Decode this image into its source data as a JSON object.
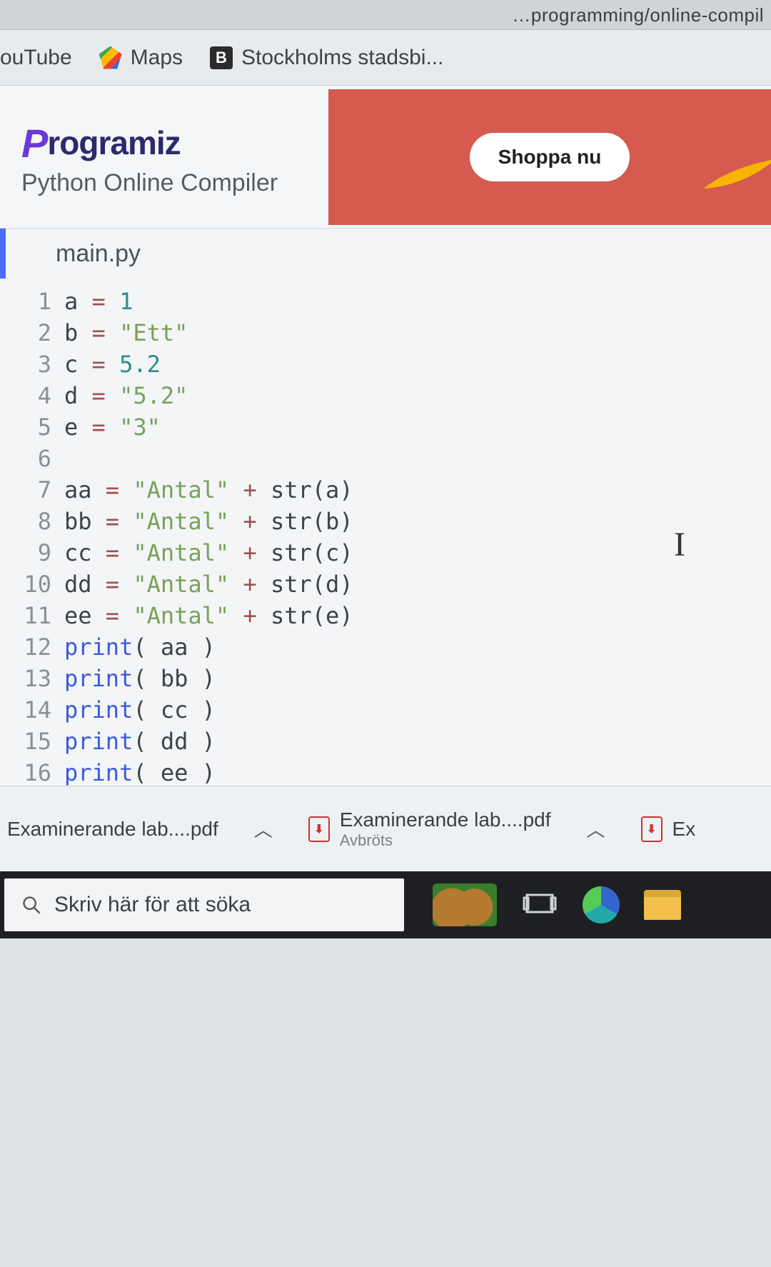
{
  "url_fragment": "…programming/online-compil",
  "bookmarks": {
    "youtube": "ouTube",
    "maps": "Maps",
    "stockholm": "Stockholms stadsbi..."
  },
  "header": {
    "brand_rest": "rogramiz",
    "subtitle": "Python Online Compiler",
    "ad_button": "Shoppa nu"
  },
  "editor": {
    "filename": "main.py",
    "lines": [
      {
        "n": "1",
        "html": "a <span class='tok-op'>=</span> <span class='tok-num'>1</span>"
      },
      {
        "n": "2",
        "html": "b <span class='tok-op'>=</span> <span class='tok-str'>\"Ett\"</span>"
      },
      {
        "n": "3",
        "html": "c <span class='tok-op'>=</span> <span class='tok-num'>5.2</span>"
      },
      {
        "n": "4",
        "html": "d <span class='tok-op'>=</span> <span class='tok-str'>\"5.2\"</span>"
      },
      {
        "n": "5",
        "html": "e <span class='tok-op'>=</span> <span class='tok-str'>\"3\"</span>"
      },
      {
        "n": "6",
        "html": ""
      },
      {
        "n": "7",
        "html": "aa <span class='tok-op'>=</span> <span class='tok-str'>\"Antal\"</span> <span class='tok-op'>+</span> str(a)"
      },
      {
        "n": "8",
        "html": "bb <span class='tok-op'>=</span> <span class='tok-str'>\"Antal\"</span> <span class='tok-op'>+</span> str(b)"
      },
      {
        "n": "9",
        "html": "cc <span class='tok-op'>=</span> <span class='tok-str'>\"Antal\"</span> <span class='tok-op'>+</span> str(c)"
      },
      {
        "n": "10",
        "html": "dd <span class='tok-op'>=</span> <span class='tok-str'>\"Antal\"</span> <span class='tok-op'>+</span> str(d)"
      },
      {
        "n": "11",
        "html": "ee <span class='tok-op'>=</span> <span class='tok-str'>\"Antal\"</span> <span class='tok-op'>+</span> str(e)"
      },
      {
        "n": "12",
        "html": "<span class='tok-kw'>print</span>( aa )"
      },
      {
        "n": "13",
        "html": "<span class='tok-kw'>print</span>( bb )"
      },
      {
        "n": "14",
        "html": "<span class='tok-kw'>print</span>( cc )"
      },
      {
        "n": "15",
        "html": "<span class='tok-kw'>print</span>( dd )"
      },
      {
        "n": "16",
        "html": "<span class='tok-kw'>print</span>( ee )"
      }
    ]
  },
  "downloads": {
    "item1": "Examinerande lab....pdf",
    "item2": "Examinerande lab....pdf",
    "item2_status": "Avbröts",
    "item3_prefix": "Ex"
  },
  "taskbar": {
    "search_placeholder": "Skriv här för att söka"
  }
}
